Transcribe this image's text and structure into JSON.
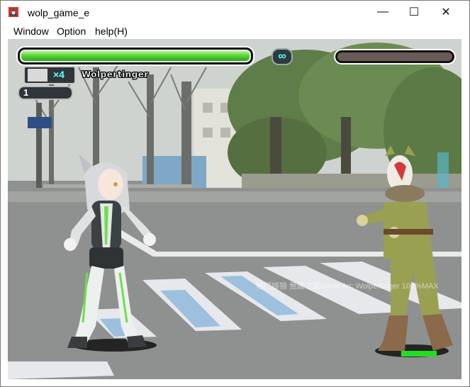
{
  "window": {
    "title": "wolp_game_e",
    "controls": {
      "minimize": "—",
      "maximize": "☐",
      "close": "✕"
    }
  },
  "menu": [
    "Window",
    "Option",
    "help(H)"
  ],
  "hud": {
    "player1": {
      "name": "Wolpertinger",
      "hp_fraction": 1.0,
      "lives": "×4",
      "meter_level": "1"
    },
    "timer": "∞",
    "player2": {
      "hp_fraction": 0.0
    }
  },
  "watermark": "格鬥娘狼 覺醒之翼Silver Arc Wolpertinger 100%MAX",
  "colors": {
    "hp_green": "#58d636",
    "p2_bar_dark": "#6a5a58",
    "enemy_green": "#9aa052",
    "enemy_hp_green": "#22dd22"
  }
}
